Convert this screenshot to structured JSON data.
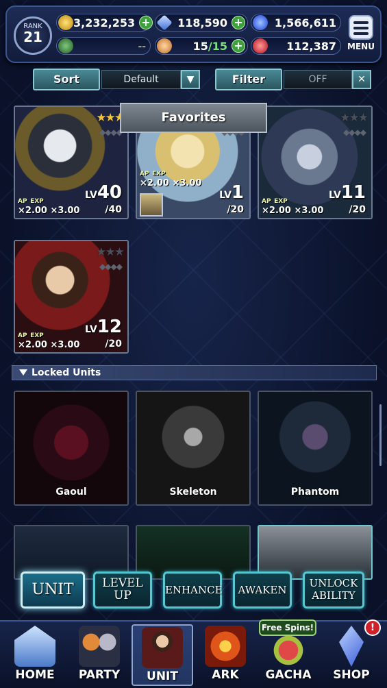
{
  "status": {
    "rank_label": "RANK",
    "rank_value": "21",
    "gold": "3,232,253",
    "crystals": "118,590",
    "blue_orbs": "1,566,611",
    "green_slot": "--",
    "stamina": "15",
    "stamina_max": "/15",
    "red_gems": "112,387",
    "menu_label": "MENU"
  },
  "sort": {
    "sort_label": "Sort",
    "sort_value": "Default",
    "filter_label": "Filter",
    "filter_value": "OFF"
  },
  "favorites_label": "Favorites",
  "units": [
    {
      "ap_tag": "AP",
      "exp_tag": "EXP",
      "ap": "×2.00",
      "exp": "×3.00",
      "lv_prefix": "LV",
      "lv": "40",
      "max": "/40",
      "stars": "★★★",
      "gems": "◆◆◆◆"
    },
    {
      "ap_tag": "AP",
      "exp_tag": "EXP",
      "ap": "×2.00",
      "exp": "×3.00",
      "lv_prefix": "LV",
      "lv": "1",
      "max": "/20",
      "stars": "★★★",
      "gems": "◆◆◆◆"
    },
    {
      "ap_tag": "AP",
      "exp_tag": "EXP",
      "ap": "×2.00",
      "exp": "×3.00",
      "lv_prefix": "LV",
      "lv": "11",
      "max": "/20",
      "stars": "★★★",
      "gems": "◆◆◆◆"
    },
    {
      "ap_tag": "AP",
      "exp_tag": "EXP",
      "ap": "×2.00",
      "exp": "×3.00",
      "lv_prefix": "LV",
      "lv": "12",
      "max": "/20",
      "stars": "★★★",
      "gems": "◆◆◆◆"
    }
  ],
  "locked_header": "Locked Units",
  "locked_units": [
    {
      "name": "Gaoul"
    },
    {
      "name": "Skeleton"
    },
    {
      "name": "Phantom"
    }
  ],
  "actions": {
    "unit": "UNIT",
    "level_up_1": "LEVEL",
    "level_up_2": "UP",
    "enhance": "ENHANCE",
    "awaken": "AWAKEN",
    "unlock_1": "UNLOCK",
    "unlock_2": "ABILITY"
  },
  "nav": {
    "home": "HOME",
    "party": "PARTY",
    "unit": "UNIT",
    "ark": "ARK",
    "gacha": "GACHA",
    "shop": "SHOP",
    "free_spins": "Free Spins!",
    "badge": "!"
  },
  "colors": {
    "accent_teal": "#57c7d1",
    "plus_green": "#3da23d",
    "alert_red": "#d0202a"
  }
}
